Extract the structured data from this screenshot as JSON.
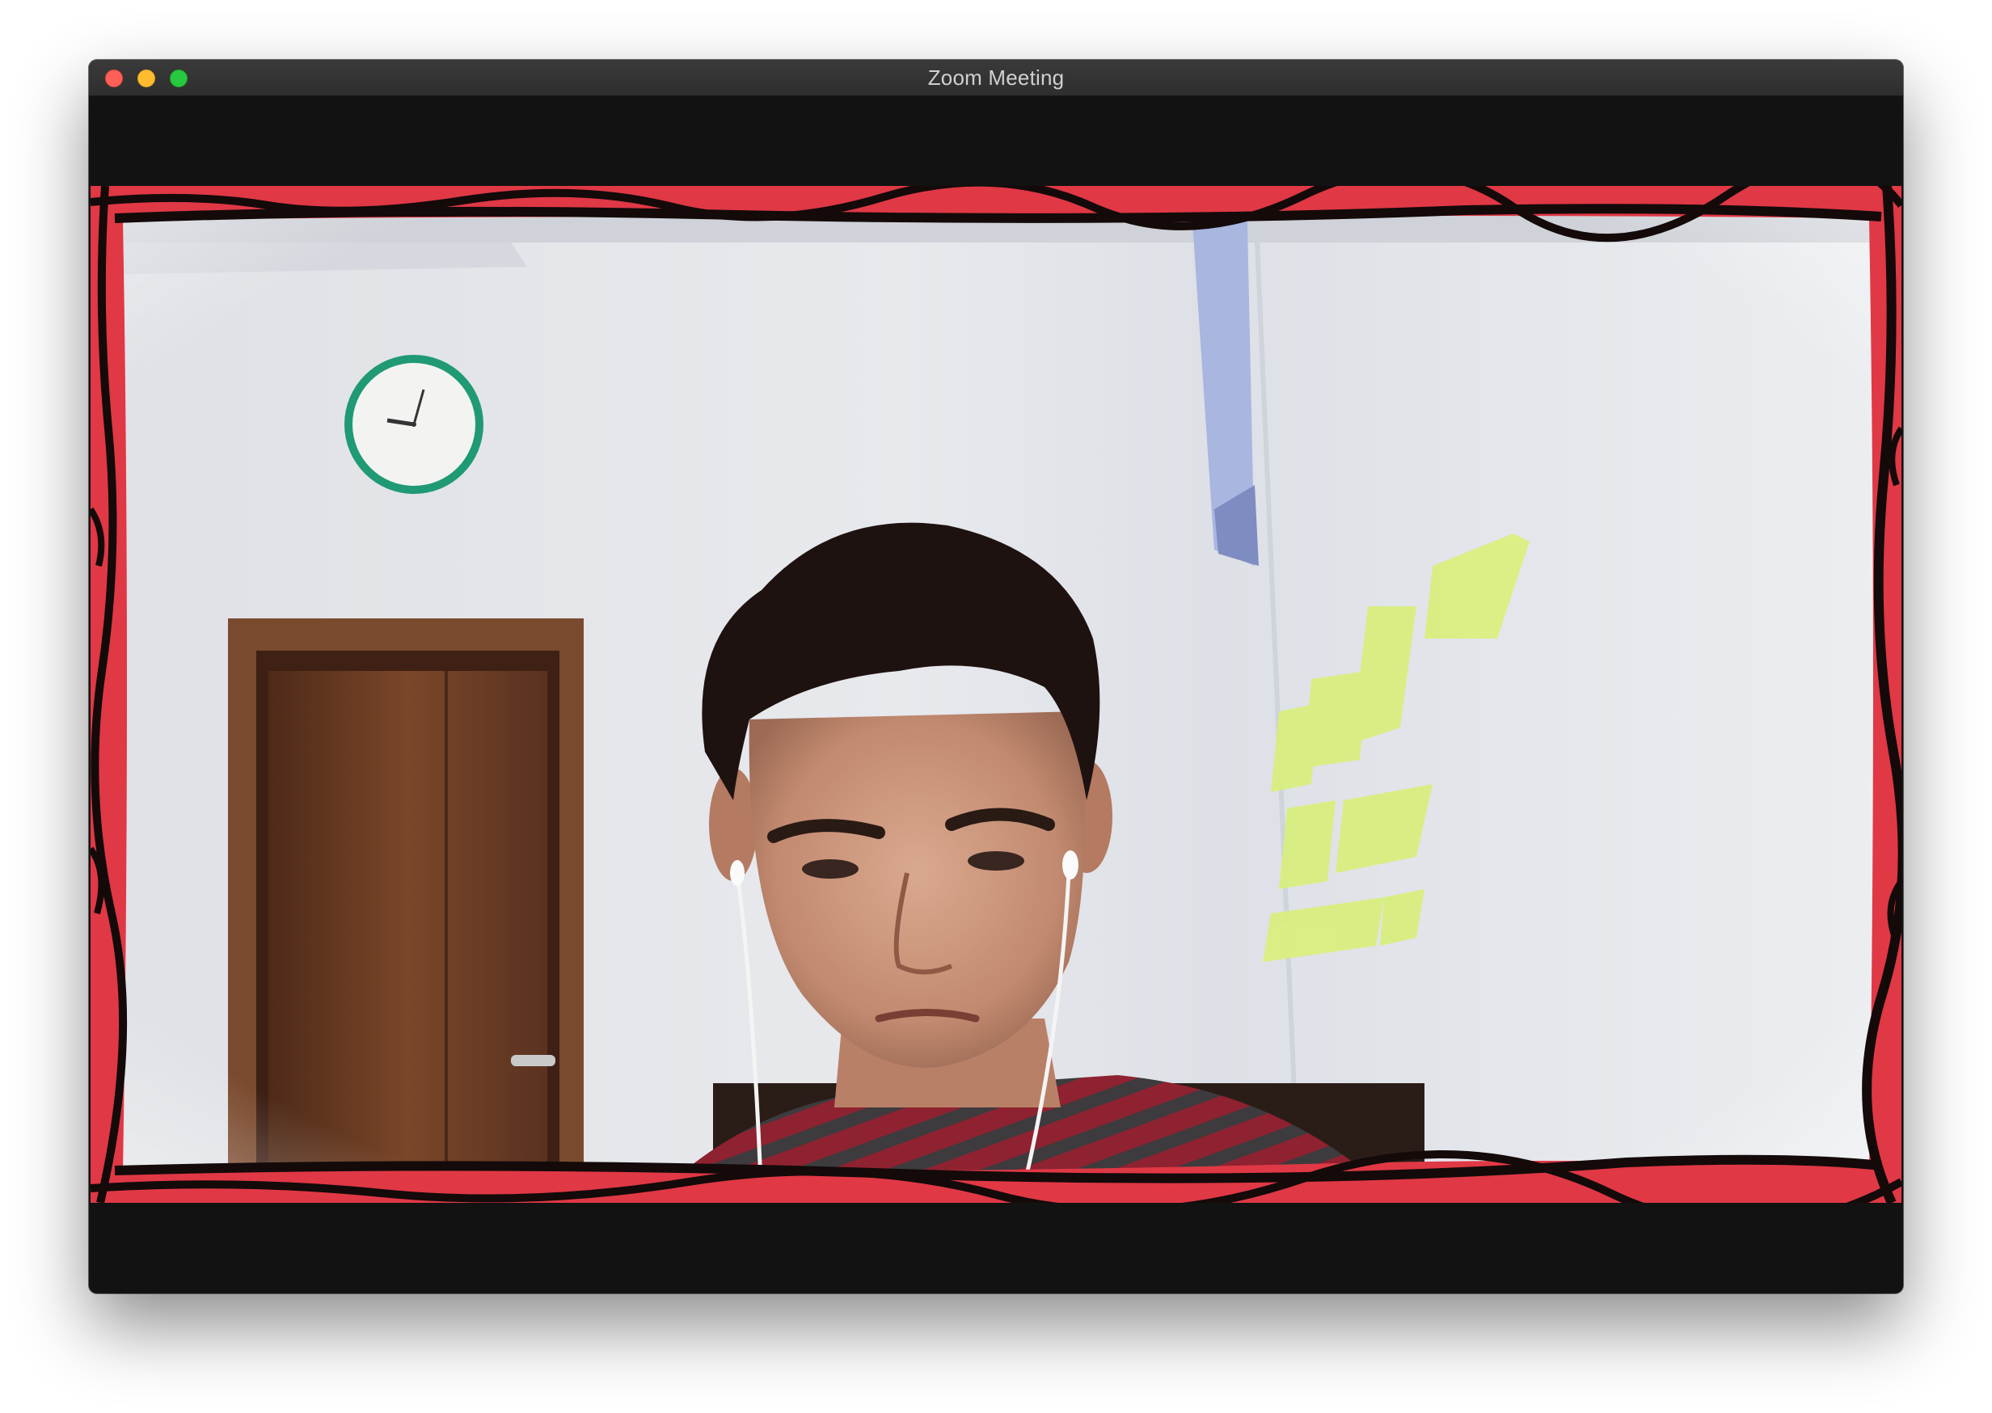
{
  "window": {
    "title": "Zoom Meeting"
  },
  "controls": {
    "close": "close-button",
    "minimize": "minimize-button",
    "zoom": "zoom-button"
  },
  "colors": {
    "frame_red": "#e03845",
    "frame_black": "#0e0a0a",
    "wall": "#e4e6ea",
    "door": "#6b3b22",
    "notes": "#d8f07a"
  }
}
